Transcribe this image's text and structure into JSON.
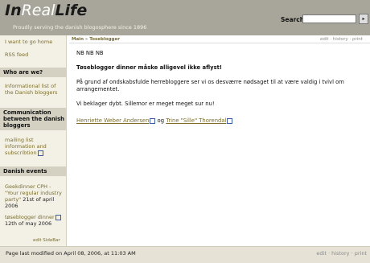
{
  "header": {
    "logo_part1": "In",
    "logo_part2": "Real",
    "logo_part3": "Life",
    "tagline": "Proudly serving the danish blogosphere since 1896",
    "search_label": "Search",
    "search_value": "",
    "search_button": "▸"
  },
  "sidebar": {
    "links": [
      "I want to go home",
      "RSS feed"
    ],
    "sections": [
      {
        "heading": "Who are we?",
        "items": [
          "Informational list of the Danish bloggers"
        ]
      },
      {
        "heading": "Communication between the danish bloggers",
        "items": [
          "mailing list information and subscribtion"
        ]
      },
      {
        "heading": "Danish events",
        "events": [
          {
            "link": "Geekdinner CPH - \"Your regular industry party\"",
            "date": "21st of april 2006"
          },
          {
            "link": "tøseblogger dinner",
            "date": "12th of may 2006"
          }
        ]
      }
    ],
    "edit_sidebar": "edit SideBar"
  },
  "breadcrumb": {
    "main": "Main",
    "separator": "»",
    "current": "Toseblogger"
  },
  "page_actions": {
    "edit": "edit",
    "history": "history",
    "print": "print",
    "sep": "·"
  },
  "content": {
    "line1": "NB NB NB",
    "heading": "Tøseblogger dinner måske alligevel ikke aflyst!",
    "para1": "På grund af ondskabsfulde herrebloggere ser vi os desværre nødsaget til at være valdig i tvivl om arrangementet.",
    "para2": "Vi beklager dybt. Sillemor er meget meget sur nu!",
    "author1": "Henriette Weber Andersen",
    "conj": "og",
    "author2": "Trine \"Sille\" Thorendal"
  },
  "footer": {
    "modified": "Page last modified on April 08, 2006, at 11:03 AM",
    "edit": "edit",
    "history": "history",
    "print": "print",
    "sep": "·"
  }
}
